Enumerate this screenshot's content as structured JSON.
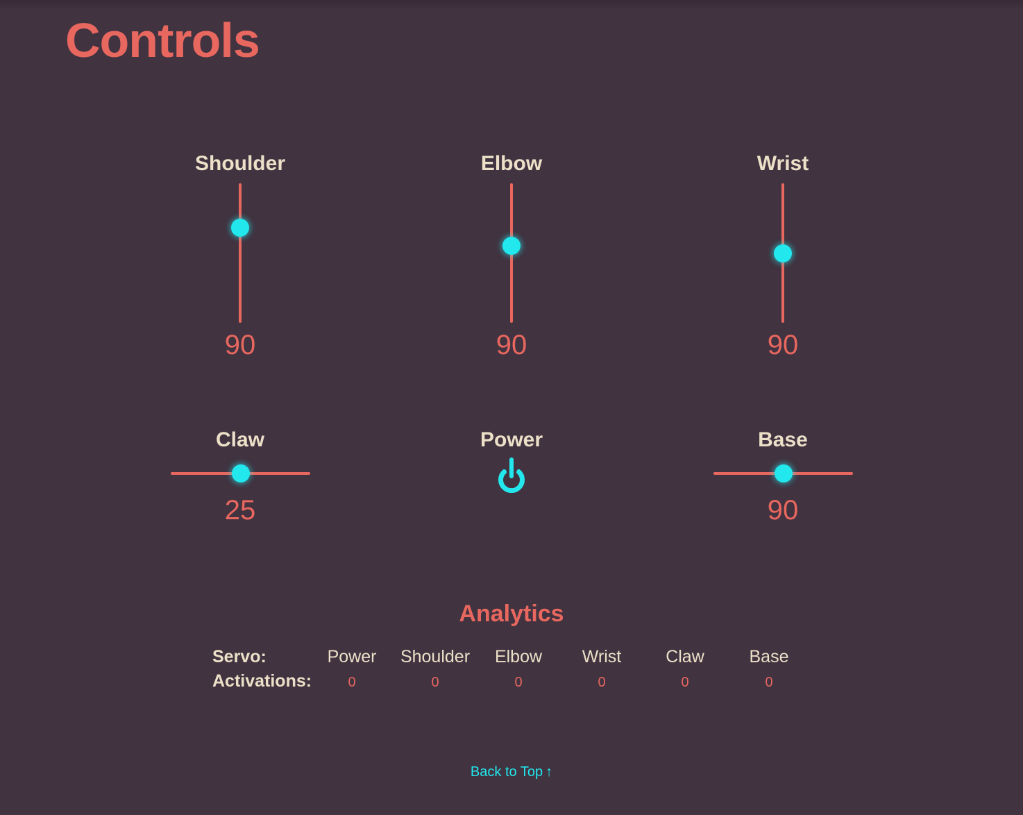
{
  "page": {
    "title": "Controls"
  },
  "colors": {
    "background": "#413340",
    "accent": "#e8675f",
    "highlight": "#22e8ee",
    "label": "#ece0c8"
  },
  "controls": {
    "shoulder": {
      "label": "Shoulder",
      "value": "90",
      "slider_level": 0.68,
      "orientation": "vertical"
    },
    "elbow": {
      "label": "Elbow",
      "value": "90",
      "slider_level": 0.55,
      "orientation": "vertical"
    },
    "wrist": {
      "label": "Wrist",
      "value": "90",
      "slider_level": 0.5,
      "orientation": "vertical"
    },
    "claw": {
      "label": "Claw",
      "value": "25",
      "slider_level": 0.5,
      "orientation": "horizontal"
    },
    "power": {
      "label": "Power",
      "icon": "power-icon"
    },
    "base": {
      "label": "Base",
      "value": "90",
      "slider_level": 0.5,
      "orientation": "horizontal"
    }
  },
  "analytics": {
    "title": "Analytics",
    "servo_label": "Servo:",
    "activations_label": "Activations:",
    "servos": [
      {
        "name": "Power",
        "activations": "0"
      },
      {
        "name": "Shoulder",
        "activations": "0"
      },
      {
        "name": "Elbow",
        "activations": "0"
      },
      {
        "name": "Wrist",
        "activations": "0"
      },
      {
        "name": "Claw",
        "activations": "0"
      },
      {
        "name": "Base",
        "activations": "0"
      }
    ]
  },
  "footer": {
    "back_to_top": "Back to Top",
    "back_to_top_icon": "arrow-up-icon"
  }
}
